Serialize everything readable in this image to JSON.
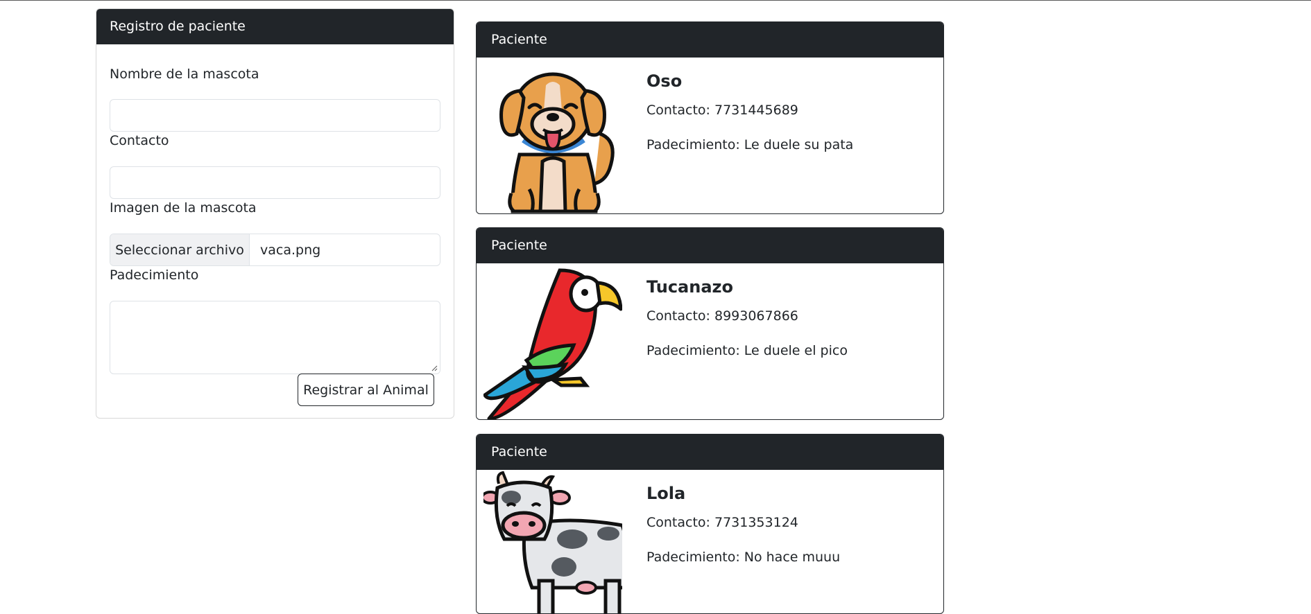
{
  "form": {
    "header": "Registro de paciente",
    "pet_name_label": "Nombre de la mascota",
    "pet_name_value": "",
    "contact_label": "Contacto",
    "contact_value": "",
    "image_label": "Imagen de la mascota",
    "file_button": "Seleccionar archivo",
    "file_name": "vaca.png",
    "condition_label": "Padecimiento",
    "condition_value": "",
    "submit_label": "Registrar al Animal"
  },
  "patients": [
    {
      "header": "Paciente",
      "name": "Oso",
      "contact": "Contacto: 7731445689",
      "condition": "Padecimiento: Le duele su pata",
      "image_icon": "dog-icon"
    },
    {
      "header": "Paciente",
      "name": "Tucanazo",
      "contact": "Contacto: 8993067866",
      "condition": "Padecimiento: Le duele el pico",
      "image_icon": "parrot-icon"
    },
    {
      "header": "Paciente",
      "name": "Lola",
      "contact": "Contacto: 7731353124",
      "condition": "Padecimiento: No hace muuu",
      "image_icon": "cow-icon"
    }
  ],
  "colors": {
    "header_bg": "#212529",
    "header_text": "#ffffff",
    "dog": "#e8a04c",
    "parrot_red": "#e8282c",
    "parrot_green": "#5bd35b",
    "parrot_blue": "#2aa6d8",
    "parrot_beak": "#f6c72a",
    "cow_spots": "#555a60"
  }
}
